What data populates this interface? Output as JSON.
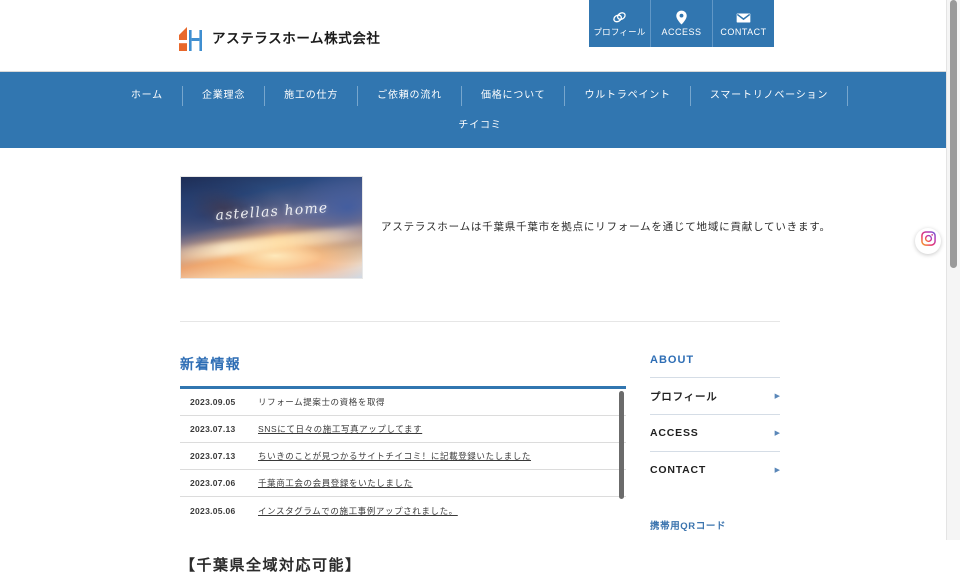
{
  "header": {
    "brand_name": "アステラスホーム株式会社",
    "logo_icon": "ah-monogram-logo",
    "util_nav": [
      {
        "label": "プロフィール",
        "icon": "profile-link-icon",
        "latin": false
      },
      {
        "label": "ACCESS",
        "icon": "map-pin-icon",
        "latin": true
      },
      {
        "label": "CONTACT",
        "icon": "envelope-icon",
        "latin": true
      }
    ]
  },
  "nav": {
    "row1": [
      "ホーム",
      "企業理念",
      "施工の仕方",
      "ご依頼の流れ",
      "価格について",
      "ウルトラペイント",
      "スマートリノベーション"
    ],
    "row2": [
      "チイコミ"
    ]
  },
  "hero": {
    "image_caption": "astellas home",
    "image_alt": "hero-cosmic-sunset-image",
    "tagline": "アステラスホームは千葉県千葉市を拠点にリフォームを通じて地域に貢献していきます。"
  },
  "news": {
    "title": "新着情報",
    "items": [
      {
        "date": "2023.09.05",
        "title": "リフォーム提案士の資格を取得",
        "is_link": false
      },
      {
        "date": "2023.07.13",
        "title": "SNSにて日々の施工写真アップしてます",
        "is_link": true
      },
      {
        "date": "2023.07.13",
        "title": "ちいきのことが見つかるサイトチイコミ！に記載登録いたしました",
        "is_link": true
      },
      {
        "date": "2023.07.06",
        "title": "千葉商工会の会員登録をいたしました",
        "is_link": true
      },
      {
        "date": "2023.05.06",
        "title": "インスタグラムでの施工事例アップされました。",
        "is_link": true
      }
    ]
  },
  "lower": {
    "heading": "【千葉県全域対応可能】"
  },
  "sidebar": {
    "title": "ABOUT",
    "items": [
      {
        "label": "プロフィール",
        "arrow": "▶"
      },
      {
        "label": "ACCESS",
        "arrow": "▶"
      },
      {
        "label": "CONTACT",
        "arrow": "▶"
      }
    ],
    "qr_label": "携帯用QRコード"
  },
  "floating": {
    "instagram_icon": "instagram-icon"
  },
  "colors": {
    "nav_blue": "#3176b0",
    "heading_blue": "#2e6eb5",
    "logo_orange": "#e8682b",
    "logo_blue": "#3f8ed0"
  }
}
